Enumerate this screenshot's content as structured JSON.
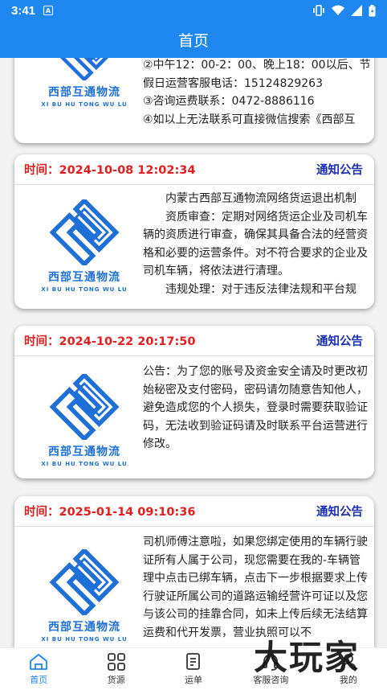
{
  "status_bar": {
    "time": "3:41",
    "notification_glyph": "A"
  },
  "app_bar": {
    "title": "首页"
  },
  "logo": {
    "name_cn": "西部互通物流",
    "name_en": "XI BU HU TONG WU LU"
  },
  "notices": [
    {
      "partial": true,
      "lines": [
        "②中午12：00-2：00、晚上18：00以后、节假日运营客服电话：15124829263",
        "③咨询运费联系：0472-8886116",
        "④如以上无法联系可直接微信搜索《西部互"
      ]
    },
    {
      "time_label": "时间：2024-10-08 12:02:34",
      "tag": "通知公告",
      "lines": [
        "内蒙古西部互通物流网络货运退出机制",
        "资质审查：定期对网络货运企业及司机车辆的资质进行审查，确保其具备合法的经营资格和必要的运营条件。对不符合要求的企业及司机车辆，将依法进行清理。",
        "违规处理：对于违反法律法规和平台规"
      ]
    },
    {
      "time_label": "时间：2024-10-22 20:17:50",
      "tag": "通知公告",
      "lines": [
        "公告：为了您的账号及资金安全请及时更改初始秘密及支付密码，密码请勿随意告知他人，避免造成您的个人损失，登录时需要获取验证码，无法收到验证码请及时联系平台运营进行修改。"
      ]
    },
    {
      "time_label": "时间：2025-01-14 09:10:36",
      "tag": "通知公告",
      "lines": [
        "司机师傅注意啦，如果您绑定使用的车辆行驶证所有人属于公司，现您需要在我的-车辆管理中点击已绑车辆，点击下一步根据要求上传行驶证所属公司的道路运输经营许可证以及您与该公司的挂靠合同，如未上传后续无法结算运费和代开发票，营业执照可以不"
      ]
    }
  ],
  "tabs": [
    {
      "label": "首页",
      "icon": "home-icon",
      "active": true
    },
    {
      "label": "货源",
      "icon": "grid-icon",
      "active": false
    },
    {
      "label": "运单",
      "icon": "waybill-icon",
      "active": false
    },
    {
      "label": "客服咨询",
      "icon": "headset-icon",
      "active": false
    },
    {
      "label": "我的",
      "icon": "user-icon",
      "active": false
    }
  ],
  "watermark": {
    "text": "大玩家"
  },
  "colors": {
    "primary": "#1e88f0",
    "time_red": "#e02020",
    "tag_blue": "#1a2fb0",
    "logo_blue": "#1e6fd8"
  }
}
